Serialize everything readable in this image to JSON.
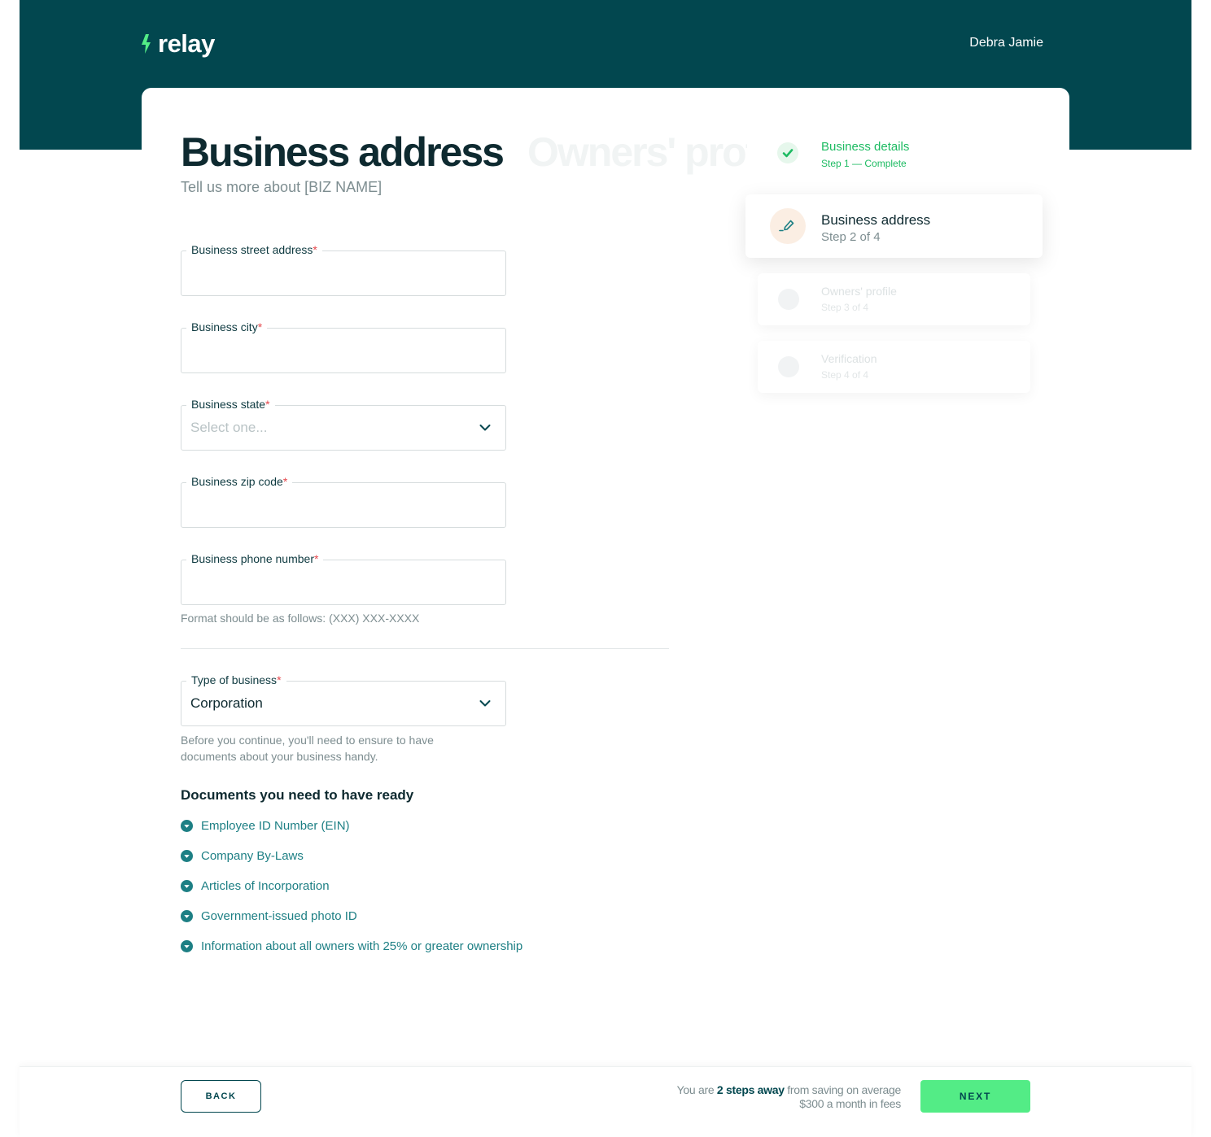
{
  "header": {
    "logo_text": "relay",
    "user_name": "Debra Jamie"
  },
  "main": {
    "title": "Business address",
    "ghost_title": "Owners' profile",
    "subtitle": "Tell us more about [BIZ NAME]"
  },
  "form": {
    "street": {
      "label": "Business street address",
      "required": "*",
      "value": ""
    },
    "city": {
      "label": "Business city",
      "required": "*",
      "value": ""
    },
    "state": {
      "label": "Business state",
      "required": "*",
      "placeholder": "Select one..."
    },
    "zip": {
      "label": "Business zip code",
      "required": "*",
      "value": ""
    },
    "phone": {
      "label": "Business phone number",
      "required": "*",
      "value": "",
      "hint": "Format should be as follows: (XXX) XXX-XXXX"
    },
    "business_type": {
      "label": "Type of business",
      "required": "*",
      "value": "Corporation",
      "hint": "Before you continue, you'll need to ensure to have documents about your business handy."
    }
  },
  "documents": {
    "heading": "Documents you need to have ready",
    "items": [
      "Employee ID Number (EIN)",
      "Company By-Laws",
      "Articles of Incorporation",
      "Government-issued photo ID",
      "Information about all owners with 25% or greater ownership"
    ]
  },
  "stepper": {
    "steps": [
      {
        "title": "Business details",
        "subtitle": "Step 1 — Complete",
        "state": "complete"
      },
      {
        "title": "Business address",
        "subtitle": "Step 2 of 4",
        "state": "active"
      },
      {
        "title": "Owners' profile",
        "subtitle": "Step 3 of 4",
        "state": "upcoming"
      },
      {
        "title": "Verification",
        "subtitle": "Step 4 of 4",
        "state": "upcoming"
      }
    ]
  },
  "footer": {
    "back_label": "BACK",
    "next_label": "NEXT",
    "msg_prefix": "You are ",
    "msg_highlight": "2 steps away",
    "msg_suffix": " from saving on average",
    "msg_line2": "$300 a month in fees"
  },
  "colors": {
    "brand_dark": "#02474f",
    "accent_green": "#53ec86",
    "complete_green": "#1dbb62",
    "link_teal": "#1d7f84",
    "required_red": "#e5484d"
  }
}
